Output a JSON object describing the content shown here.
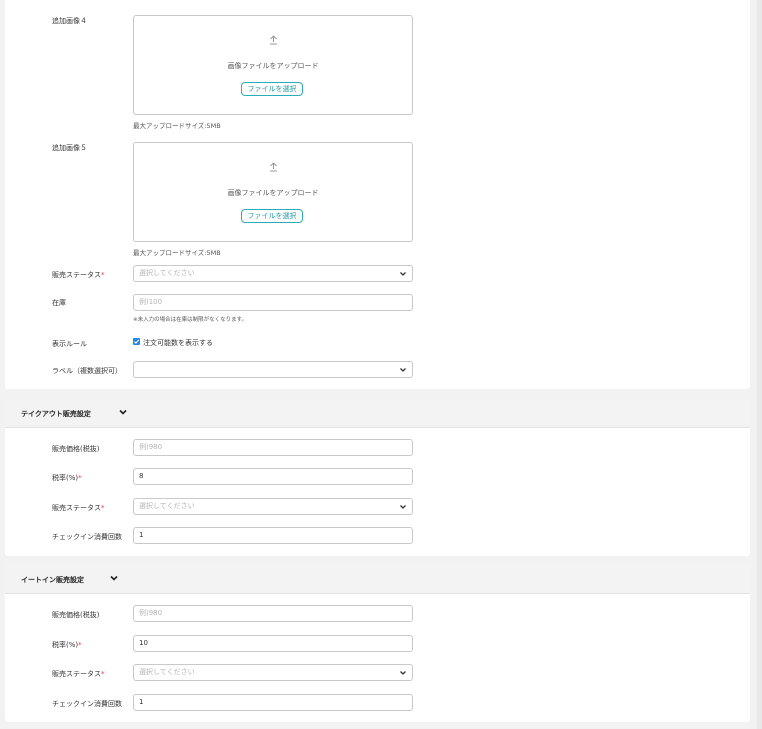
{
  "product_section": {
    "image4": {
      "label": "追加画像４",
      "upload_text": "画像ファイルをアップロード",
      "button": "ファイルを選択",
      "note": "最大アップロードサイズ:5MB"
    },
    "image5": {
      "label": "追加画像５",
      "upload_text": "画像ファイルをアップロード",
      "button": "ファイルを選択",
      "note": "最大アップロードサイズ:5MB"
    },
    "sales_status": {
      "label": "販売ステータス",
      "required": "*",
      "placeholder": "選択してください"
    },
    "stock": {
      "label": "在庫",
      "placeholder": "例)100",
      "note": "※未入力の場合は在庫は制限がなくなります。"
    },
    "display_rule": {
      "label": "表示ルール",
      "checkbox_label": "注文可能数を表示する",
      "checked": true
    },
    "labels": {
      "label": "ラベル（複数選択可）",
      "value": ""
    }
  },
  "takeout": {
    "title": "テイクアウト販売設定",
    "price": {
      "label": "販売価格(税抜)",
      "placeholder": "例)980"
    },
    "tax": {
      "label": "税率(%)",
      "required": "*",
      "value": "8"
    },
    "sales_status": {
      "label": "販売ステータス",
      "required": "*",
      "placeholder": "選択してください"
    },
    "checkin": {
      "label": "チェックイン消費回数",
      "value": "1"
    }
  },
  "eatin": {
    "title": "イートイン販売設定",
    "price": {
      "label": "販売価格(税抜)",
      "placeholder": "例)980"
    },
    "tax": {
      "label": "税率(%)",
      "required": "*",
      "value": "10"
    },
    "sales_status": {
      "label": "販売ステータス",
      "required": "*",
      "placeholder": "選択してください"
    },
    "checkin": {
      "label": "チェックイン消費回数",
      "value": "1"
    }
  },
  "icons": {
    "upload": "upload-icon",
    "chevron": "chevron-down-icon",
    "check": "checkbox-checked-icon"
  },
  "colors": {
    "accent": "#29aeb7",
    "required": "#e53935",
    "checkbox": "#1e88e5"
  }
}
